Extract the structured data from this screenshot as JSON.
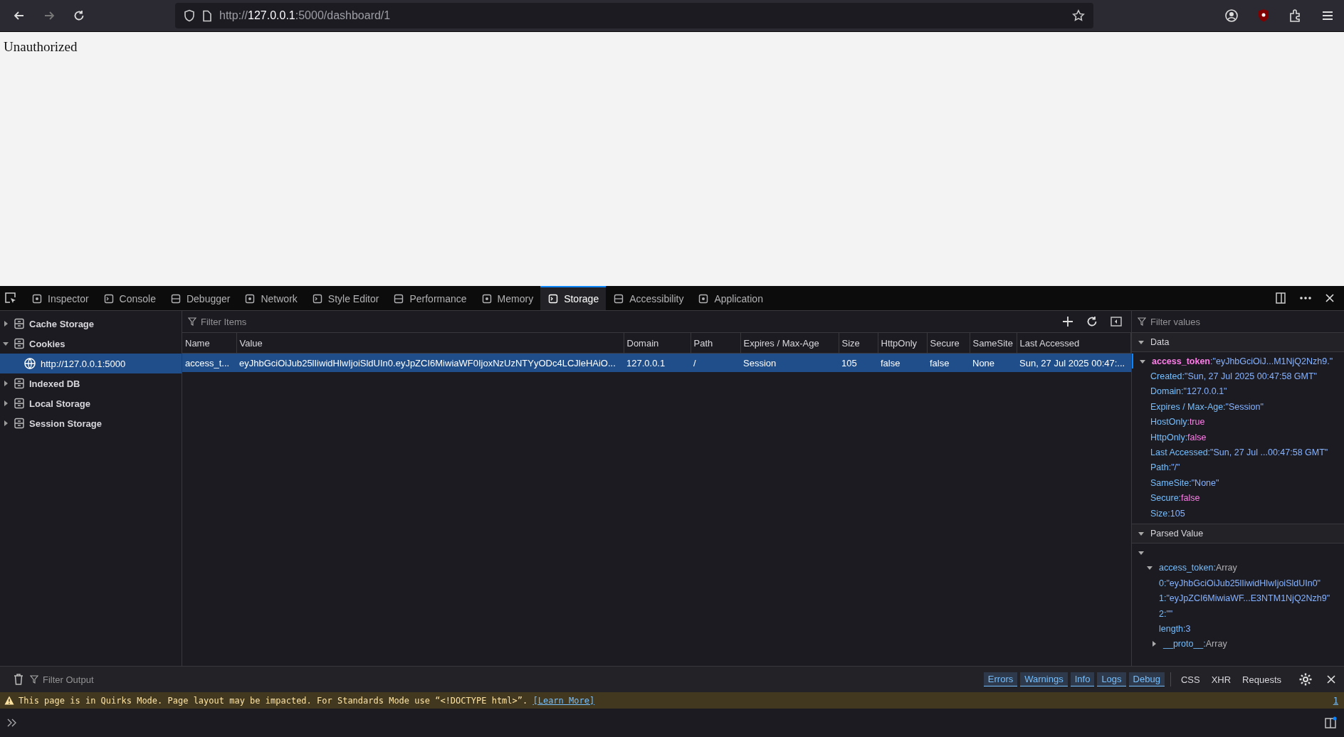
{
  "browser": {
    "url": {
      "scheme": "http://",
      "host": "127.0.0.1",
      "rest": ":5000/dashboard/1"
    }
  },
  "page": {
    "text": "Unauthorized"
  },
  "devtools": {
    "tabs": [
      {
        "label": "Inspector",
        "selected": false
      },
      {
        "label": "Console",
        "selected": false
      },
      {
        "label": "Debugger",
        "selected": false
      },
      {
        "label": "Network",
        "selected": false
      },
      {
        "label": "Style Editor",
        "selected": false
      },
      {
        "label": "Performance",
        "selected": false
      },
      {
        "label": "Memory",
        "selected": false
      },
      {
        "label": "Storage",
        "selected": true
      },
      {
        "label": "Accessibility",
        "selected": false
      },
      {
        "label": "Application",
        "selected": false
      }
    ]
  },
  "storage_tree": [
    {
      "label": "Cache Storage",
      "expanded": false,
      "selected": false
    },
    {
      "label": "Cookies",
      "expanded": true,
      "selected": false,
      "children": [
        {
          "label": "http://127.0.0.1:5000",
          "selected": true
        }
      ]
    },
    {
      "label": "Indexed DB",
      "expanded": false,
      "selected": false
    },
    {
      "label": "Local Storage",
      "expanded": false,
      "selected": false
    },
    {
      "label": "Session Storage",
      "expanded": false,
      "selected": false
    }
  ],
  "table": {
    "filter_placeholder": "Filter Items",
    "columns": [
      "Name",
      "Value",
      "Domain",
      "Path",
      "Expires / Max-Age",
      "Size",
      "HttpOnly",
      "Secure",
      "SameSite",
      "Last Accessed"
    ],
    "rows": [
      {
        "selected": true,
        "cells": [
          "access_t...",
          "eyJhbGciOiJub25lIiwidHlwIjoiSldUIn0.eyJpZCI6MiwiaWF0IjoxNzUzNTYyODc4LCJleHAiO...",
          "127.0.0.1",
          "/",
          "Session",
          "105",
          "false",
          "false",
          "None",
          "Sun, 27 Jul 2025 00:47:..."
        ]
      }
    ]
  },
  "sidebar": {
    "filter_placeholder": "Filter values",
    "data": {
      "title": "Data",
      "expanded": true,
      "key": "access_token",
      "value": ":\"eyJhbGciOiJ...M1NjQ2Nzh9.\"",
      "entries": [
        {
          "key": "Created:",
          "value": "\"Sun, 27 Jul 2025 00:47:58 GMT\"",
          "kind": "string"
        },
        {
          "key": "Domain:",
          "value": "\"127.0.0.1\"",
          "kind": "string"
        },
        {
          "key": "Expires / Max-Age:",
          "value": "\"Session\"",
          "kind": "string"
        },
        {
          "key": "HostOnly:",
          "value": "true",
          "kind": "boolean"
        },
        {
          "key": "HttpOnly:",
          "value": "false",
          "kind": "boolean"
        },
        {
          "key": "Last Accessed:",
          "value": "\"Sun, 27 Jul ...00:47:58 GMT\"",
          "kind": "string"
        },
        {
          "key": "Path:",
          "value": "\"/\"",
          "kind": "string"
        },
        {
          "key": "SameSite:",
          "value": "\"None\"",
          "kind": "string"
        },
        {
          "key": "Secure:",
          "value": "false",
          "kind": "boolean"
        },
        {
          "key": "Size:",
          "value": "105",
          "kind": "number"
        }
      ]
    },
    "parsed": {
      "title": "Parsed Value",
      "expanded": true,
      "tree": [
        {
          "expanded": true,
          "children": [
            {
              "key": "access_token:",
              "value": "Array",
              "expanded": true,
              "children": [
                {
                  "key": "0:",
                  "value": "\"eyJhbGciOiJub25lIiwidHlwIjoiSldUIn0\"",
                  "kind": "value"
                },
                {
                  "key": "1:",
                  "value": "\"eyJpZCI6MiwiaWF...E3NTM1NjQ2Nzh9\"",
                  "kind": "value"
                },
                {
                  "key": "2:",
                  "value": "\"\"",
                  "kind": "value"
                },
                {
                  "key": "length:",
                  "value": "3",
                  "kind": "value"
                },
                {
                  "key": "__proto__:",
                  "value": "Array",
                  "kind": "object",
                  "expanded": false
                }
              ]
            }
          ]
        }
      ]
    }
  },
  "console": {
    "filter_placeholder": "Filter Output",
    "levels": [
      {
        "label": "Errors",
        "selected": true
      },
      {
        "label": "Warnings",
        "selected": true
      },
      {
        "label": "Info",
        "selected": true
      },
      {
        "label": "Logs",
        "selected": true
      },
      {
        "label": "Debug",
        "selected": true
      }
    ],
    "types": [
      {
        "label": "CSS",
        "selected": false
      },
      {
        "label": "XHR",
        "selected": false
      },
      {
        "label": "Requests",
        "selected": false
      }
    ],
    "messages": [
      {
        "text": "This page is in Quirks Mode. Page layout may be impacted. For Standards Mode use “<!DOCTYPE html>”.",
        "link": "[Learn More]",
        "count": "1"
      }
    ]
  }
}
